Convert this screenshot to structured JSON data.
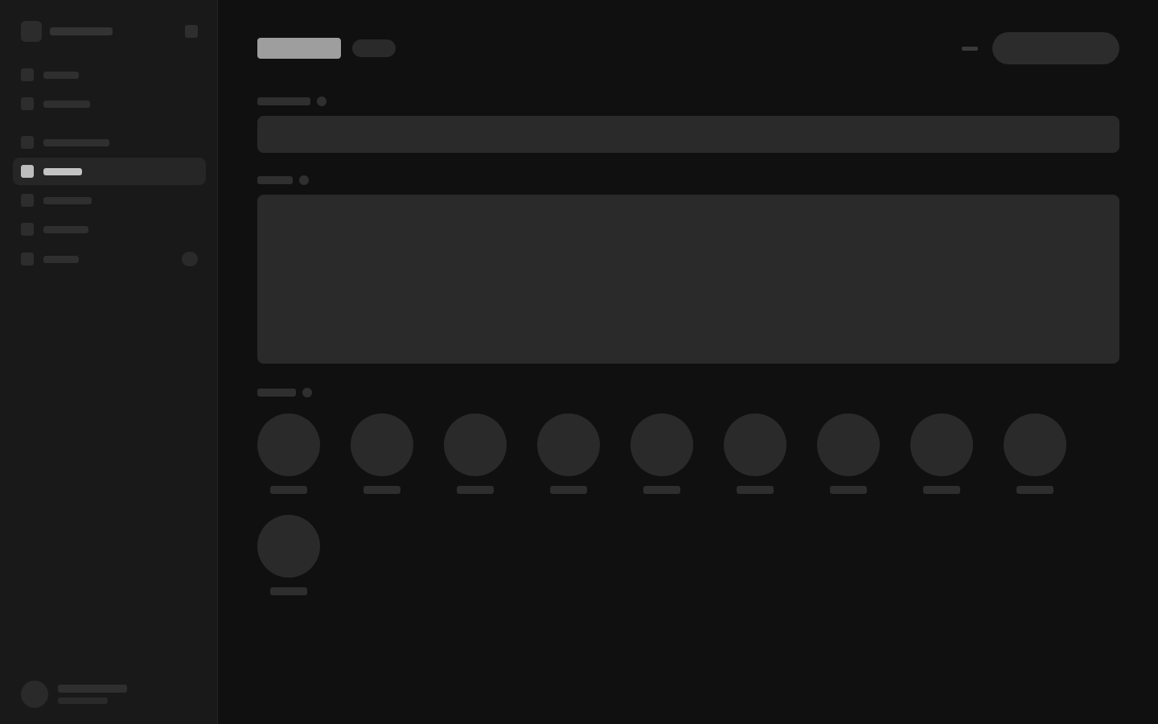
{
  "app": {
    "brand_name": "",
    "user": {
      "name": "",
      "email": ""
    }
  },
  "sidebar": {
    "items": [
      {
        "label": "",
        "icon": "home-icon",
        "active": false
      },
      {
        "label": "",
        "icon": "inbox-icon",
        "active": false
      },
      {
        "label": "",
        "icon": "folder-icon",
        "active": false
      },
      {
        "label": "",
        "icon": "edit-icon",
        "active": true
      },
      {
        "label": "",
        "icon": "calendar-icon",
        "active": false
      },
      {
        "label": "",
        "icon": "users-icon",
        "active": false
      },
      {
        "label": "",
        "icon": "bell-icon",
        "active": false,
        "badge": ""
      }
    ]
  },
  "header": {
    "title": "",
    "tag": "",
    "secondary_action": "",
    "primary_action": ""
  },
  "form": {
    "name_field": {
      "label": "",
      "value": "",
      "placeholder": ""
    },
    "description_field": {
      "label": "",
      "value": "",
      "placeholder": ""
    },
    "options": {
      "label": "",
      "items": [
        {
          "label": ""
        },
        {
          "label": ""
        },
        {
          "label": ""
        },
        {
          "label": ""
        },
        {
          "label": ""
        },
        {
          "label": ""
        },
        {
          "label": ""
        },
        {
          "label": ""
        },
        {
          "label": ""
        },
        {
          "label": ""
        }
      ]
    }
  },
  "colors": {
    "page_background": "#101010",
    "sidebar_background": "#191919",
    "active_nav_background": "#262626",
    "active_highlight": "#c4c4c4",
    "surface": "#2a2a2a"
  }
}
